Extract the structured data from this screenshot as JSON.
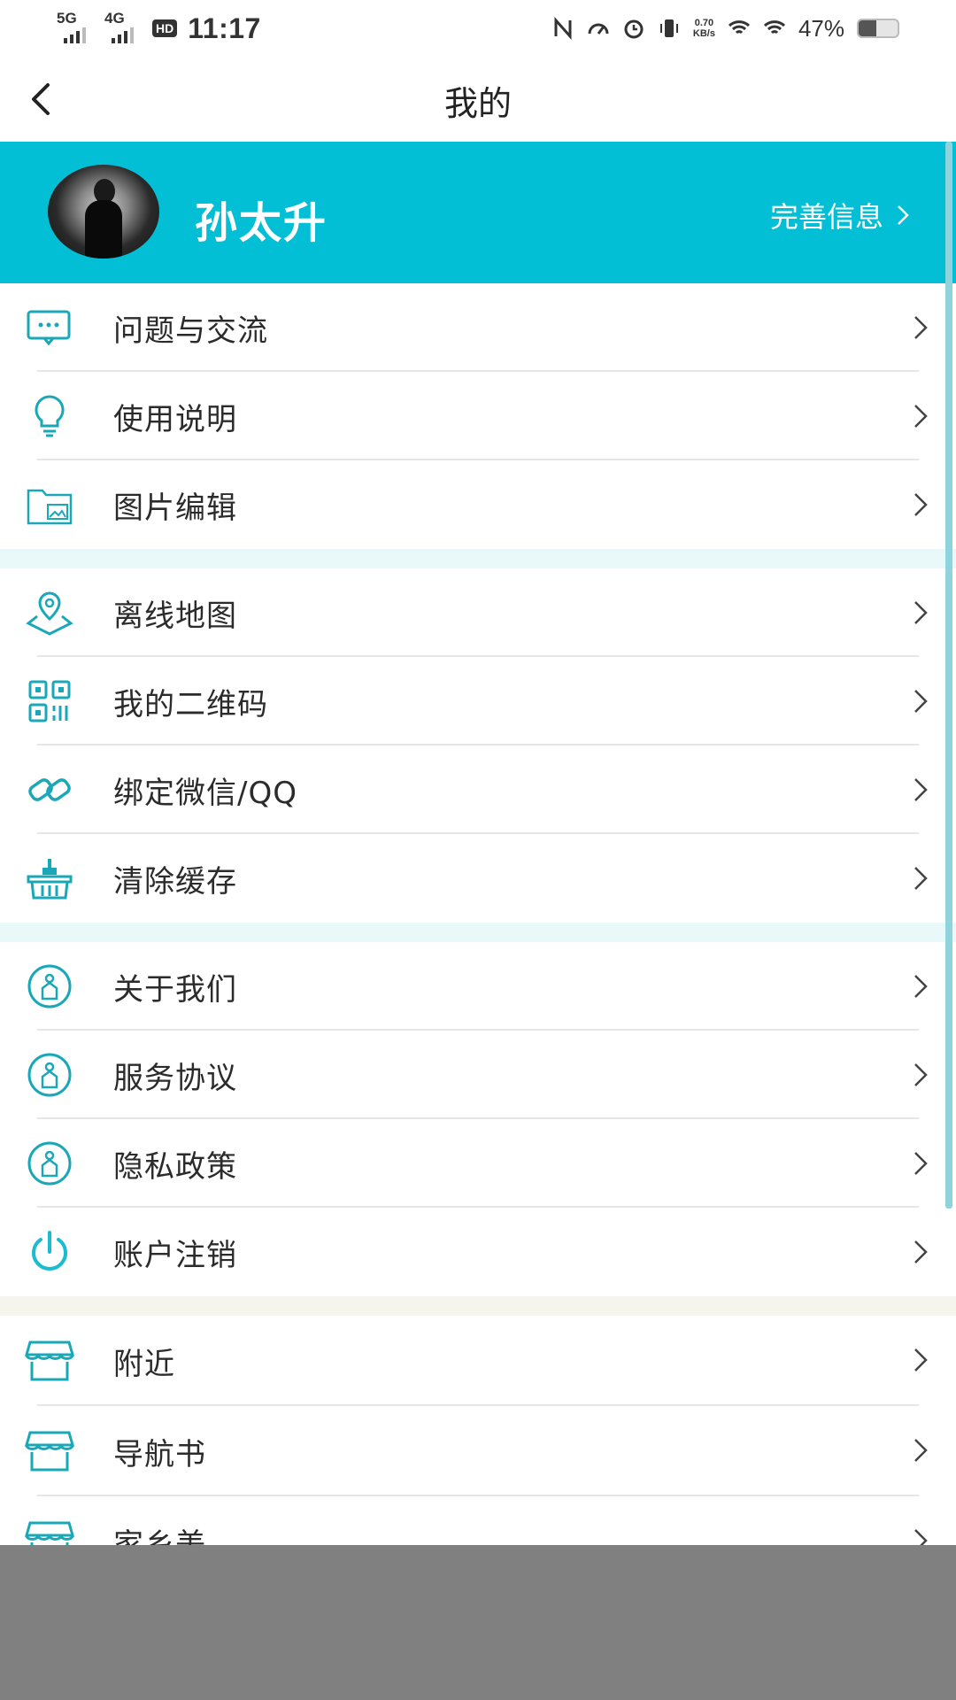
{
  "status_bar": {
    "sim1": "5G",
    "sim2": "4G",
    "hd": "HD",
    "time": "11:17",
    "speed_value": "0.70",
    "speed_unit": "KB/s",
    "battery": "47%"
  },
  "nav": {
    "title": "我的"
  },
  "profile": {
    "name": "孙太升",
    "complete_label": "完善信息",
    "accent_color": "#03bfd6"
  },
  "groups": [
    {
      "items": [
        {
          "label": "问题与交流",
          "icon": "chat-bubble-icon"
        },
        {
          "label": "使用说明",
          "icon": "lightbulb-icon"
        },
        {
          "label": "图片编辑",
          "icon": "image-folder-icon"
        }
      ]
    },
    {
      "items": [
        {
          "label": "离线地图",
          "icon": "map-pin-icon"
        },
        {
          "label": "我的二维码",
          "icon": "qr-code-icon"
        },
        {
          "label": "绑定微信/QQ",
          "icon": "link-icon"
        },
        {
          "label": "清除缓存",
          "icon": "broom-basket-icon"
        }
      ]
    },
    {
      "items": [
        {
          "label": "关于我们",
          "icon": "info-badge-icon"
        },
        {
          "label": "服务协议",
          "icon": "info-badge-icon"
        },
        {
          "label": "隐私政策",
          "icon": "info-badge-icon"
        },
        {
          "label": "账户注销",
          "icon": "power-icon"
        }
      ]
    },
    {
      "items": [
        {
          "label": "附近",
          "icon": "store-icon"
        },
        {
          "label": "导航书",
          "icon": "store-icon"
        },
        {
          "label": "家乡美",
          "icon": "store-icon"
        }
      ]
    }
  ]
}
